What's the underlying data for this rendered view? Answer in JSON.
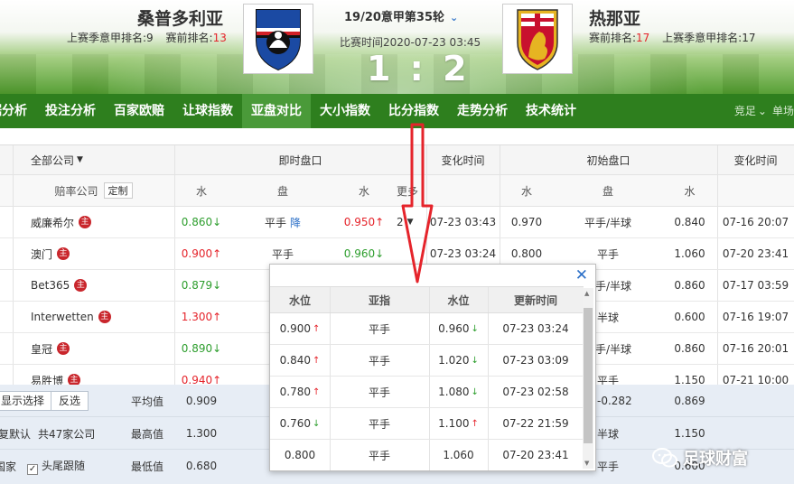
{
  "header": {
    "home_team": "桑普多利亚",
    "home_last_rank_label": "上赛季意甲排名:9",
    "home_pre_rank_label": "赛前排名:",
    "home_pre_rank": "13",
    "round": "19/20意甲第35轮",
    "match_time": "比赛时间2020-07-23 03:45",
    "score": "1 : 2",
    "away_team": "热那亚",
    "away_pre_rank_label": "赛前排名:",
    "away_pre_rank": "17",
    "away_last_rank_label": "上赛季意甲排名:17"
  },
  "nav": {
    "tabs": [
      "据分析",
      "投注分析",
      "百家欧赔",
      "让球指数",
      "亚盘对比",
      "大小指数",
      "比分指数",
      "走势分析",
      "技术统计"
    ],
    "active": 4,
    "right_items": [
      "竞足",
      "单场"
    ]
  },
  "table": {
    "header1": {
      "company": "全部公司",
      "live": "即时盘口",
      "change_time": "变化时间",
      "initial": "初始盘口",
      "change_time2": "变化时间"
    },
    "header2": {
      "odds_company": "赔率公司",
      "customize": "定制",
      "water1": "水",
      "handicap": "盘",
      "water2": "水",
      "more": "更多",
      "init_water1": "水",
      "init_handicap": "盘",
      "init_water2": "水"
    },
    "rows": [
      {
        "company": "威廉希尔",
        "badge": "主",
        "w1": "0.860",
        "w1_dir": "down",
        "hc": "平手",
        "hc_note": "降",
        "w2": "0.950",
        "w2_dir": "up",
        "more": "2",
        "time": "07-23 03:43",
        "iw1": "0.970",
        "ihc": "平手/半球",
        "iw2": "0.840",
        "itime": "07-16 20:07"
      },
      {
        "company": "澳门",
        "badge": "主",
        "w1": "0.900",
        "w1_dir": "up",
        "hc": "平手",
        "hc_note": "",
        "w2": "0.960",
        "w2_dir": "down",
        "more": "",
        "time": "07-23 03:24",
        "iw1": "0.800",
        "ihc": "平手",
        "iw2": "1.060",
        "itime": "07-20 23:41"
      },
      {
        "company": "Bet365",
        "badge": "主",
        "w1": "0.879",
        "w1_dir": "down",
        "hc": "",
        "hc_note": "",
        "w2": "",
        "w2_dir": "",
        "more": "",
        "time": "",
        "iw1": "",
        "ihc": "平手/半球",
        "iw2": "0.860",
        "itime": "07-17 03:59"
      },
      {
        "company": "Interwetten",
        "badge": "主",
        "w1": "1.300",
        "w1_dir": "up",
        "hc": "",
        "hc_note": "",
        "w2": "",
        "w2_dir": "",
        "more": "",
        "time": "",
        "iw1": "",
        "ihc": "半球",
        "iw2": "0.600",
        "itime": "07-16 19:07"
      },
      {
        "company": "皇冠",
        "badge": "主",
        "w1": "0.890",
        "w1_dir": "down",
        "hc": "",
        "hc_note": "",
        "w2": "",
        "w2_dir": "",
        "more": "",
        "time": "",
        "iw1": "",
        "ihc": "平手/半球",
        "iw2": "0.860",
        "itime": "07-16 20:01"
      },
      {
        "company": "易胜博",
        "badge": "主",
        "w1": "0.940",
        "w1_dir": "up",
        "hc": "",
        "hc_note": "",
        "w2": "",
        "w2_dir": "",
        "more": "",
        "time": "",
        "iw1": "",
        "ihc": "平手",
        "iw2": "1.150",
        "itime": "07-21 10:00"
      }
    ]
  },
  "footer": {
    "show_select": "显示选择",
    "reverse_select": "反选",
    "default_label": "恢复默认",
    "company_count": "共47家公司",
    "country_label": "国家",
    "head_tail_label": "头尾跟随",
    "stats": [
      {
        "label": "平均值",
        "w1": "0.909",
        "iw1": "-0.282",
        "iw2": "0.869"
      },
      {
        "label": "最高值",
        "w1": "1.300",
        "ihc": "半球",
        "iw2": "1.150"
      },
      {
        "label": "最低值",
        "w1": "0.680",
        "ihc": "平手",
        "iw2": "0.600"
      }
    ]
  },
  "popup": {
    "headers": [
      "水位",
      "亚指",
      "水位",
      "更新时间"
    ],
    "rows": [
      {
        "w1": "0.900",
        "w1_dir": "up",
        "hc": "平手",
        "w2": "0.960",
        "w2_dir": "down",
        "time": "07-23 03:24"
      },
      {
        "w1": "0.840",
        "w1_dir": "up",
        "hc": "平手",
        "w2": "1.020",
        "w2_dir": "down",
        "time": "07-23 03:09"
      },
      {
        "w1": "0.780",
        "w1_dir": "up",
        "hc": "平手",
        "w2": "1.080",
        "w2_dir": "down",
        "time": "07-23 02:58"
      },
      {
        "w1": "0.760",
        "w1_dir": "down",
        "hc": "平手",
        "w2": "1.100",
        "w2_dir": "up",
        "time": "07-22 21:59"
      },
      {
        "w1": "0.800",
        "w1_dir": "",
        "hc": "平手",
        "w2": "1.060",
        "w2_dir": "",
        "time": "07-20 23:41"
      }
    ]
  },
  "watermark": {
    "text": "足球财富"
  },
  "colors": {
    "up": "#e5242b",
    "down": "#2e9e2e",
    "nav": "#2e7f1e",
    "nav_active": "#4a9a39",
    "link": "#2b6fc7"
  }
}
